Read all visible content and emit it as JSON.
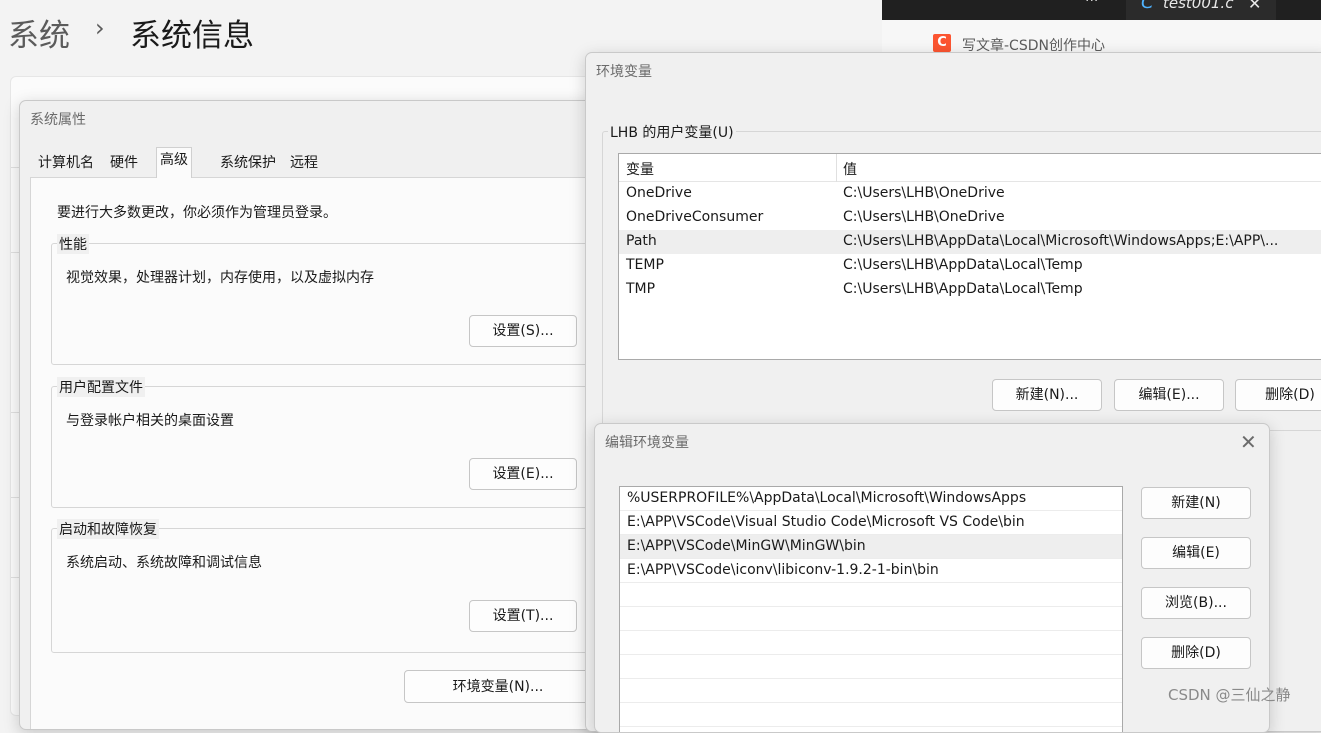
{
  "settings": {
    "breadcrumb_parent": "系统",
    "breadcrumb_current": "系统信息"
  },
  "browser": {
    "file_tab": "test001.c",
    "csdn_tab": "写文章-CSDN创作中心"
  },
  "system_properties": {
    "title": "系统属性",
    "tabs": [
      "计算机名",
      "硬件",
      "高级",
      "系统保护",
      "远程"
    ],
    "admin_note": "要进行大多数更改，你必须作为管理员登录。",
    "performance": {
      "label": "性能",
      "desc": "视觉效果，处理器计划，内存使用，以及虚拟内存",
      "button": "设置(S)..."
    },
    "user_profiles": {
      "label": "用户配置文件",
      "desc": "与登录帐户相关的桌面设置",
      "button": "设置(E)..."
    },
    "startup_recovery": {
      "label": "启动和故障恢复",
      "desc": "系统启动、系统故障和调试信息",
      "button": "设置(T)..."
    },
    "env_button": "环境变量(N)..."
  },
  "environment_variables": {
    "title": "环境变量",
    "user_group_label": "LHB 的用户变量(U)",
    "columns": [
      "变量",
      "值"
    ],
    "rows": [
      {
        "name": "OneDrive",
        "value": "C:\\Users\\LHB\\OneDrive"
      },
      {
        "name": "OneDriveConsumer",
        "value": "C:\\Users\\LHB\\OneDrive"
      },
      {
        "name": "Path",
        "value": "C:\\Users\\LHB\\AppData\\Local\\Microsoft\\WindowsApps;E:\\APP\\..."
      },
      {
        "name": "TEMP",
        "value": "C:\\Users\\LHB\\AppData\\Local\\Temp"
      },
      {
        "name": "TMP",
        "value": "C:\\Users\\LHB\\AppData\\Local\\Temp"
      }
    ],
    "buttons": {
      "new": "新建(N)...",
      "edit": "编辑(E)...",
      "delete": "删除(D)"
    }
  },
  "edit_env": {
    "title": "编辑环境变量",
    "paths": [
      "%USERPROFILE%\\AppData\\Local\\Microsoft\\WindowsApps",
      "E:\\APP\\VSCode\\Visual Studio Code\\Microsoft VS Code\\bin",
      "E:\\APP\\VSCode\\MinGW\\MinGW\\bin",
      "E:\\APP\\VSCode\\iconv\\libiconv-1.9.2-1-bin\\bin"
    ],
    "buttons": {
      "new": "新建(N)",
      "edit": "编辑(E)",
      "browse": "浏览(B)...",
      "delete": "删除(D)"
    }
  },
  "watermark": "CSDN @三仙之静"
}
